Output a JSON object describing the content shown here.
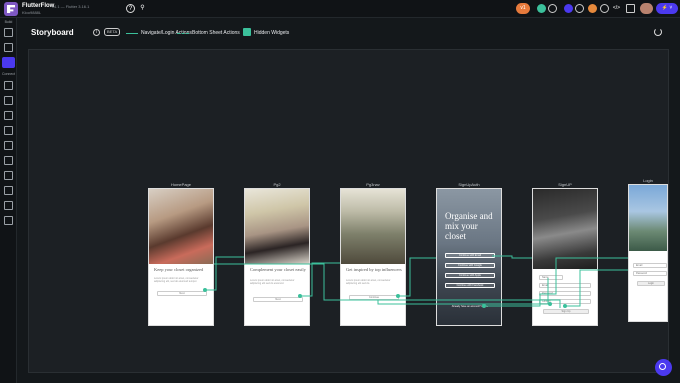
{
  "topbar": {
    "app_name": "FlutterFlow",
    "version": "v4.1 — Flutter 3.16.1",
    "project": "Kloo9888L",
    "chip_left": "v1"
  },
  "sidebar": {
    "build_label": "Build",
    "connect_label": "Connect"
  },
  "header": {
    "title": "Storyboard",
    "beta": "BETA",
    "legend_nav": "Navigate/Login Actions",
    "legend_bottom": "Bottom Sheet Actions",
    "legend_hidden": "Hidden Widgets"
  },
  "pages": [
    {
      "label": "HomePage",
      "headline": "Keep your closet organized",
      "body": "Lorem ipsum dolor sit amet, consectetur adipiscing elit, sed do eiusmod tempor.",
      "button": "Next"
    },
    {
      "label": "Pg2",
      "headline": "Complement your closet easily",
      "body": "Lorem ipsum dolor sit amet, consectetur adipiscing elit sed do eiusmod.",
      "button": "Next"
    },
    {
      "label": "Pg3nav",
      "headline": "Get inspired by top influencers",
      "body": "Lorem ipsum dolor sit amet, consectetur adipiscing elit sed do.",
      "button": "Continue"
    },
    {
      "label": "SignUpAuth",
      "headline": "Organise and mix your closet",
      "buttons": [
        "Continue with Email",
        "Continue with Google",
        "Continue with Apple",
        "Continue with Facebook"
      ],
      "footer": "Already have an account? Log in"
    },
    {
      "label": "SignUP",
      "headline": "",
      "fields": [
        "Name",
        "Email",
        "Password",
        "Confirm"
      ],
      "button": "Sign Up"
    },
    {
      "label": "Login",
      "headline": "",
      "fields": [
        "Email",
        "Password"
      ],
      "button": "Login"
    }
  ],
  "colors": {
    "accent": "#4b39ef",
    "link": "#3bc09b"
  }
}
